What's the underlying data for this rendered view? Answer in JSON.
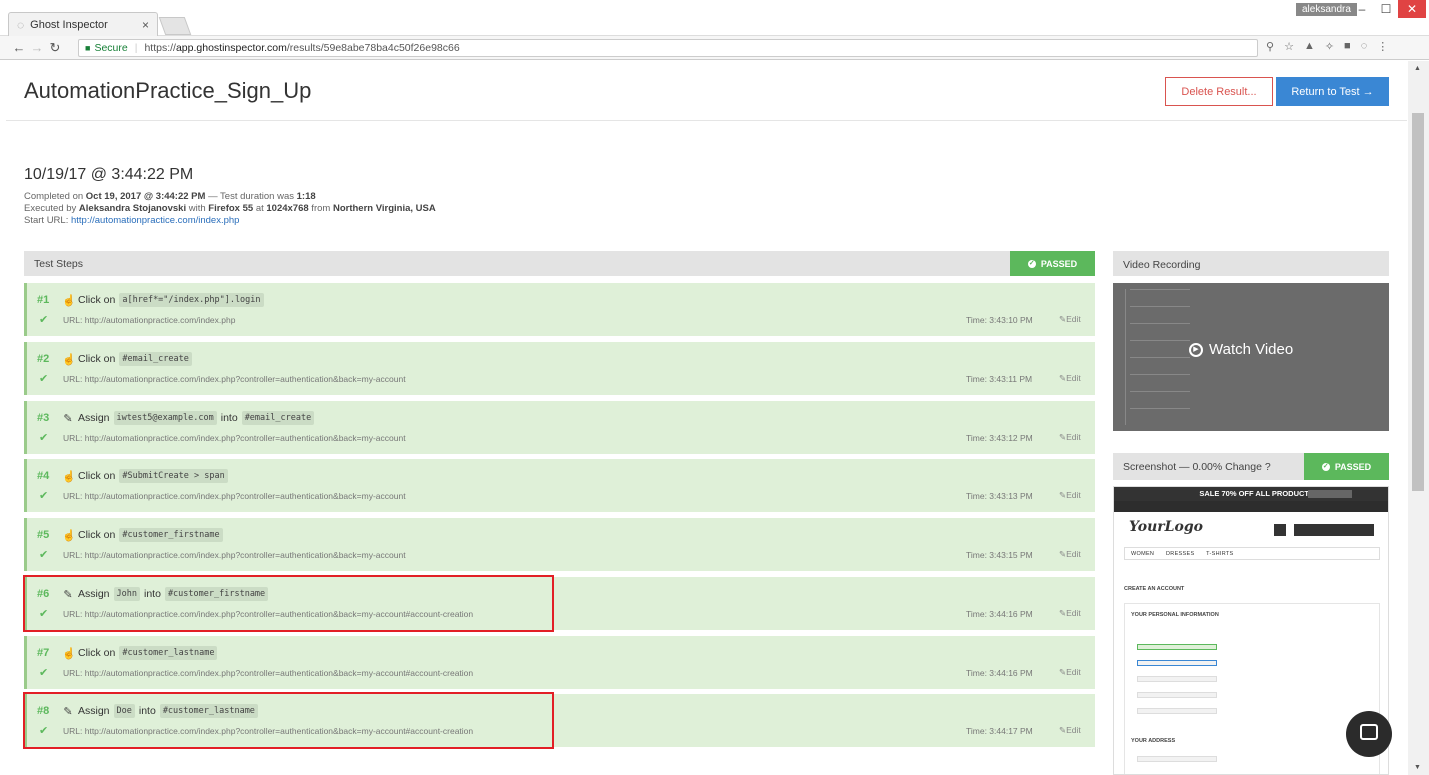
{
  "browser": {
    "tab_title": "Ghost Inspector",
    "tab_close": "×",
    "user_badge": "aleksandra",
    "secure_label": "Secure",
    "url_scheme": "https://",
    "url_host": "app.ghostinspector.com",
    "url_path": "/results/59e8abe78ba4c50f26e98c66",
    "win_min": "–",
    "win_max": "☐",
    "win_close": "✕"
  },
  "header": {
    "title": "AutomationPractice_Sign_Up",
    "delete_label": "Delete Result...",
    "return_label": "Return to Test →"
  },
  "summary": {
    "date": "10/19/17 @ 3:44:22 PM",
    "completed_prefix": "Completed on ",
    "completed_on": "Oct 19, 2017 @ 3:44:22 PM",
    "duration_prefix": " — Test duration was ",
    "duration": "1:18",
    "executed_prefix": "Executed by ",
    "executor": "Aleksandra Stojanovski",
    "with_word": " with ",
    "browser": "Firefox 55",
    "at_word": " at ",
    "resolution": "1024x768",
    "from_word": " from ",
    "location": "Northern Virginia, USA",
    "start_url_label": "Start URL: ",
    "start_url": "http://automationpractice.com/index.php"
  },
  "steps_panel": {
    "title": "Test Steps",
    "status": "PASSED"
  },
  "steps": [
    {
      "num": "#1",
      "action": "Click on",
      "target": "a[href*=\"/index.php\"].login",
      "url": "URL: http://automationpractice.com/index.php",
      "time": "Time: 3:43:10 PM",
      "edit": "Edit"
    },
    {
      "num": "#2",
      "action": "Click on",
      "target": "#email_create",
      "url": "URL: http://automationpractice.com/index.php?controller=authentication&back=my-account",
      "time": "Time: 3:43:11 PM",
      "edit": "Edit"
    },
    {
      "num": "#3",
      "action": "Assign",
      "value": "iwtest5@example.com",
      "into": "into",
      "target": "#email_create",
      "url": "URL: http://automationpractice.com/index.php?controller=authentication&back=my-account",
      "time": "Time: 3:43:12 PM",
      "edit": "Edit"
    },
    {
      "num": "#4",
      "action": "Click on",
      "target": "#SubmitCreate > span",
      "url": "URL: http://automationpractice.com/index.php?controller=authentication&back=my-account",
      "time": "Time: 3:43:13 PM",
      "edit": "Edit"
    },
    {
      "num": "#5",
      "action": "Click on",
      "target": "#customer_firstname",
      "url": "URL: http://automationpractice.com/index.php?controller=authentication&back=my-account",
      "time": "Time: 3:43:15 PM",
      "edit": "Edit"
    },
    {
      "num": "#6",
      "action": "Assign",
      "value": "John",
      "into": "into",
      "target": "#customer_firstname",
      "url": "URL: http://automationpractice.com/index.php?controller=authentication&back=my-account#account-creation",
      "time": "Time: 3:44:16 PM",
      "edit": "Edit"
    },
    {
      "num": "#7",
      "action": "Click on",
      "target": "#customer_lastname",
      "url": "URL: http://automationpractice.com/index.php?controller=authentication&back=my-account#account-creation",
      "time": "Time: 3:44:16 PM",
      "edit": "Edit"
    },
    {
      "num": "#8",
      "action": "Assign",
      "value": "Doe",
      "into": "into",
      "target": "#customer_lastname",
      "url": "URL: http://automationpractice.com/index.php?controller=authentication&back=my-account#account-creation",
      "time": "Time: 3:44:17 PM",
      "edit": "Edit"
    }
  ],
  "video": {
    "title": "Video Recording",
    "watch_label": "Watch Video"
  },
  "screenshot": {
    "title": "Screenshot — 0.00% Change",
    "status": "PASSED",
    "banner": "SALE 70% OFF ALL PRODUCTS",
    "logo": "YourLogo",
    "menu": [
      "WOMEN",
      "DRESSES",
      "T-SHIRTS"
    ],
    "create_account": "CREATE AN ACCOUNT",
    "personal_info": "YOUR PERSONAL INFORMATION",
    "your_address": "YOUR ADDRESS"
  },
  "colors": {
    "passed": "#5cb85c",
    "step_bg": "#dff0d8",
    "highlight": "#e21f26",
    "primary": "#3a87d4",
    "danger": "#d9534f"
  }
}
